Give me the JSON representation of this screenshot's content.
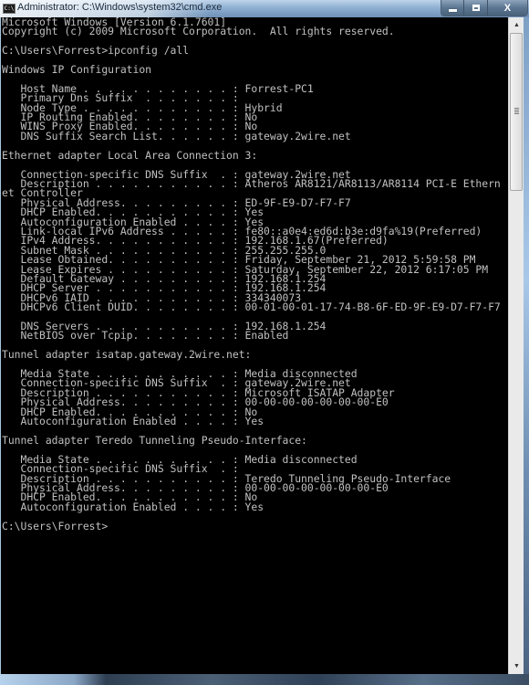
{
  "window": {
    "title": "Administrator: C:\\Windows\\system32\\cmd.exe",
    "app_icon_label": "C:\\",
    "buttons": {
      "minimize": "minimize",
      "maximize": "restore",
      "close": "X"
    }
  },
  "console": {
    "lines": [
      "Microsoft Windows [Version 6.1.7601]",
      "Copyright (c) 2009 Microsoft Corporation.  All rights reserved.",
      "",
      "C:\\Users\\Forrest>ipconfig /all",
      "",
      "Windows IP Configuration",
      "",
      "   Host Name . . . . . . . . . . . . : Forrest-PC1",
      "   Primary Dns Suffix  . . . . . . . :",
      "   Node Type . . . . . . . . . . . . : Hybrid",
      "   IP Routing Enabled. . . . . . . . : No",
      "   WINS Proxy Enabled. . . . . . . . : No",
      "   DNS Suffix Search List. . . . . . : gateway.2wire.net",
      "",
      "Ethernet adapter Local Area Connection 3:",
      "",
      "   Connection-specific DNS Suffix  . : gateway.2wire.net",
      "   Description . . . . . . . . . . . : Atheros AR8121/AR8113/AR8114 PCI-E Ethern",
      "et Controller",
      "   Physical Address. . . . . . . . . : ED-9F-E9-D7-F7-F7",
      "   DHCP Enabled. . . . . . . . . . . : Yes",
      "   Autoconfiguration Enabled . . . . : Yes",
      "   Link-local IPv6 Address . . . . . : fe80::a0e4:ed6d:b3e:d9fa%19(Preferred)",
      "   IPv4 Address. . . . . . . . . . . : 192.168.1.67(Preferred)",
      "   Subnet Mask . . . . . . . . . . . : 255.255.255.0",
      "   Lease Obtained. . . . . . . . . . : Friday, September 21, 2012 5:59:58 PM",
      "   Lease Expires . . . . . . . . . . : Saturday, September 22, 2012 6:17:05 PM",
      "   Default Gateway . . . . . . . . . : 192.168.1.254",
      "   DHCP Server . . . . . . . . . . . : 192.168.1.254",
      "   DHCPv6 IAID . . . . . . . . . . . : 334340073",
      "   DHCPv6 Client DUID. . . . . . . . : 00-01-00-01-17-74-B8-6F-ED-9F-E9-D7-F7-F7",
      "",
      "   DNS Servers . . . . . . . . . . . : 192.168.1.254",
      "   NetBIOS over Tcpip. . . . . . . . : Enabled",
      "",
      "Tunnel adapter isatap.gateway.2wire.net:",
      "",
      "   Media State . . . . . . . . . . . : Media disconnected",
      "   Connection-specific DNS Suffix  . : gateway.2wire.net",
      "   Description . . . . . . . . . . . : Microsoft ISATAP Adapter",
      "   Physical Address. . . . . . . . . : 00-00-00-00-00-00-00-E0",
      "   DHCP Enabled. . . . . . . . . . . : No",
      "   Autoconfiguration Enabled . . . . : Yes",
      "",
      "Tunnel adapter Teredo Tunneling Pseudo-Interface:",
      "",
      "   Media State . . . . . . . . . . . : Media disconnected",
      "   Connection-specific DNS Suffix  . :",
      "   Description . . . . . . . . . . . : Teredo Tunneling Pseudo-Interface",
      "   Physical Address. . . . . . . . . : 00-00-00-00-00-00-00-E0",
      "   DHCP Enabled. . . . . . . . . . . : No",
      "   Autoconfiguration Enabled . . . . : Yes",
      "",
      "C:\\Users\\Forrest>"
    ]
  },
  "scrollbar": {
    "up_arrow": "▲",
    "down_arrow": "▼"
  },
  "colors": {
    "console_bg": "#000000",
    "console_text": "#c0c0c0"
  }
}
